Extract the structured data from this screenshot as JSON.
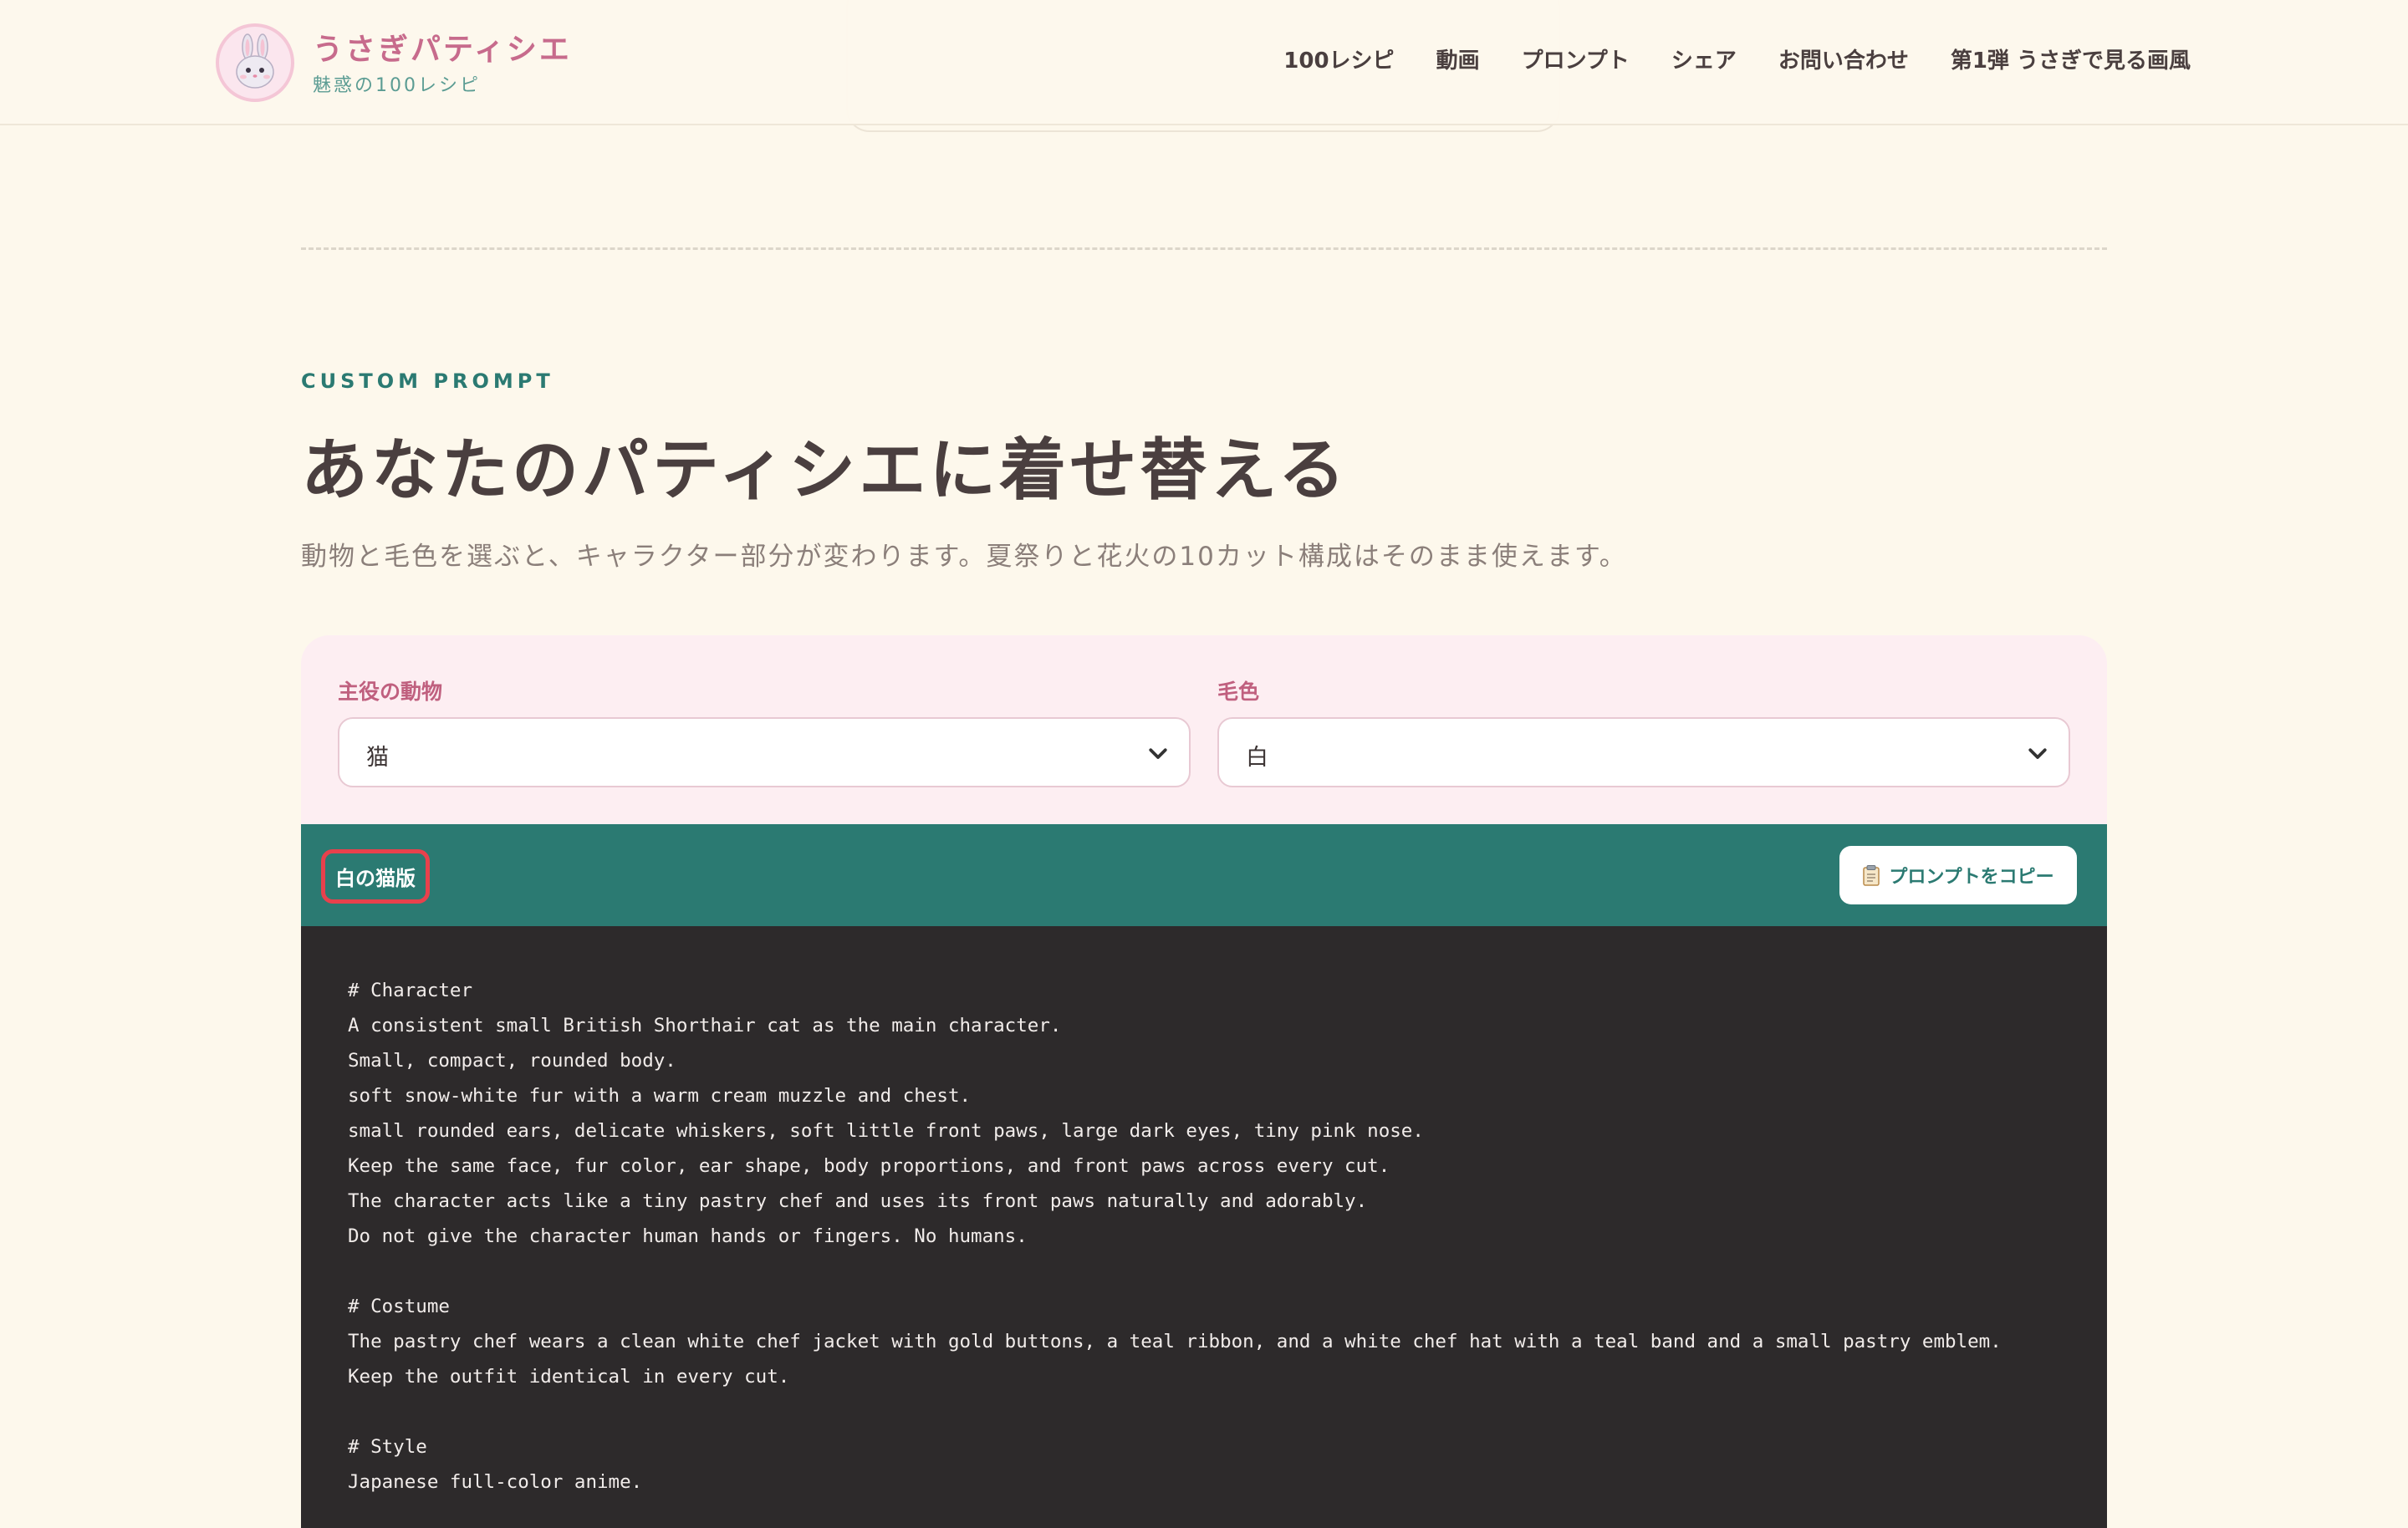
{
  "header": {
    "brand_title": "うさぎパティシエ",
    "brand_subtitle": "魅惑の100レシピ",
    "logo_icon": "rabbit-face-icon",
    "nav": [
      {
        "label": "100レシピ"
      },
      {
        "label": "動画"
      },
      {
        "label": "プロンプト"
      },
      {
        "label": "シェア"
      },
      {
        "label": "お問い合わせ"
      },
      {
        "label": "第1弾 うさぎで見る画風"
      }
    ]
  },
  "section": {
    "eyebrow": "CUSTOM PROMPT",
    "title": "あなたのパティシエに着せ替える",
    "lead": "動物と毛色を選ぶと、キャラクター部分が変わります。夏祭りと花火の10カット構成はそのまま使えます。"
  },
  "selectors": {
    "animal_label": "主役の動物",
    "animal_value": "猫",
    "color_label": "毛色",
    "color_value": "白"
  },
  "prompt": {
    "variant_label": "白の猫版",
    "copy_button": "プロンプトをコピー",
    "copy_icon": "clipboard-icon",
    "text": "# Character\nA consistent small British Shorthair cat as the main character.\nSmall, compact, rounded body.\nsoft snow-white fur with a warm cream muzzle and chest.\nsmall rounded ears, delicate whiskers, soft little front paws, large dark eyes, tiny pink nose.\nKeep the same face, fur color, ear shape, body proportions, and front paws across every cut.\nThe character acts like a tiny pastry chef and uses its front paws naturally and adorably.\nDo not give the character human hands or fingers. No humans.\n\n# Costume\nThe pastry chef wears a clean white chef jacket with gold buttons, a teal ribbon, and a white chef hat with a teal band and a small pastry emblem.\nKeep the outfit identical in every cut.\n\n# Style\nJapanese full-color anime."
  },
  "colors": {
    "background": "#fdf8ec",
    "brand_pink": "#c76b8c",
    "teal": "#2b7a72",
    "panel_pink": "#fdeef2",
    "code_bg": "#2d2a2b",
    "highlight_red": "#e8414c"
  }
}
